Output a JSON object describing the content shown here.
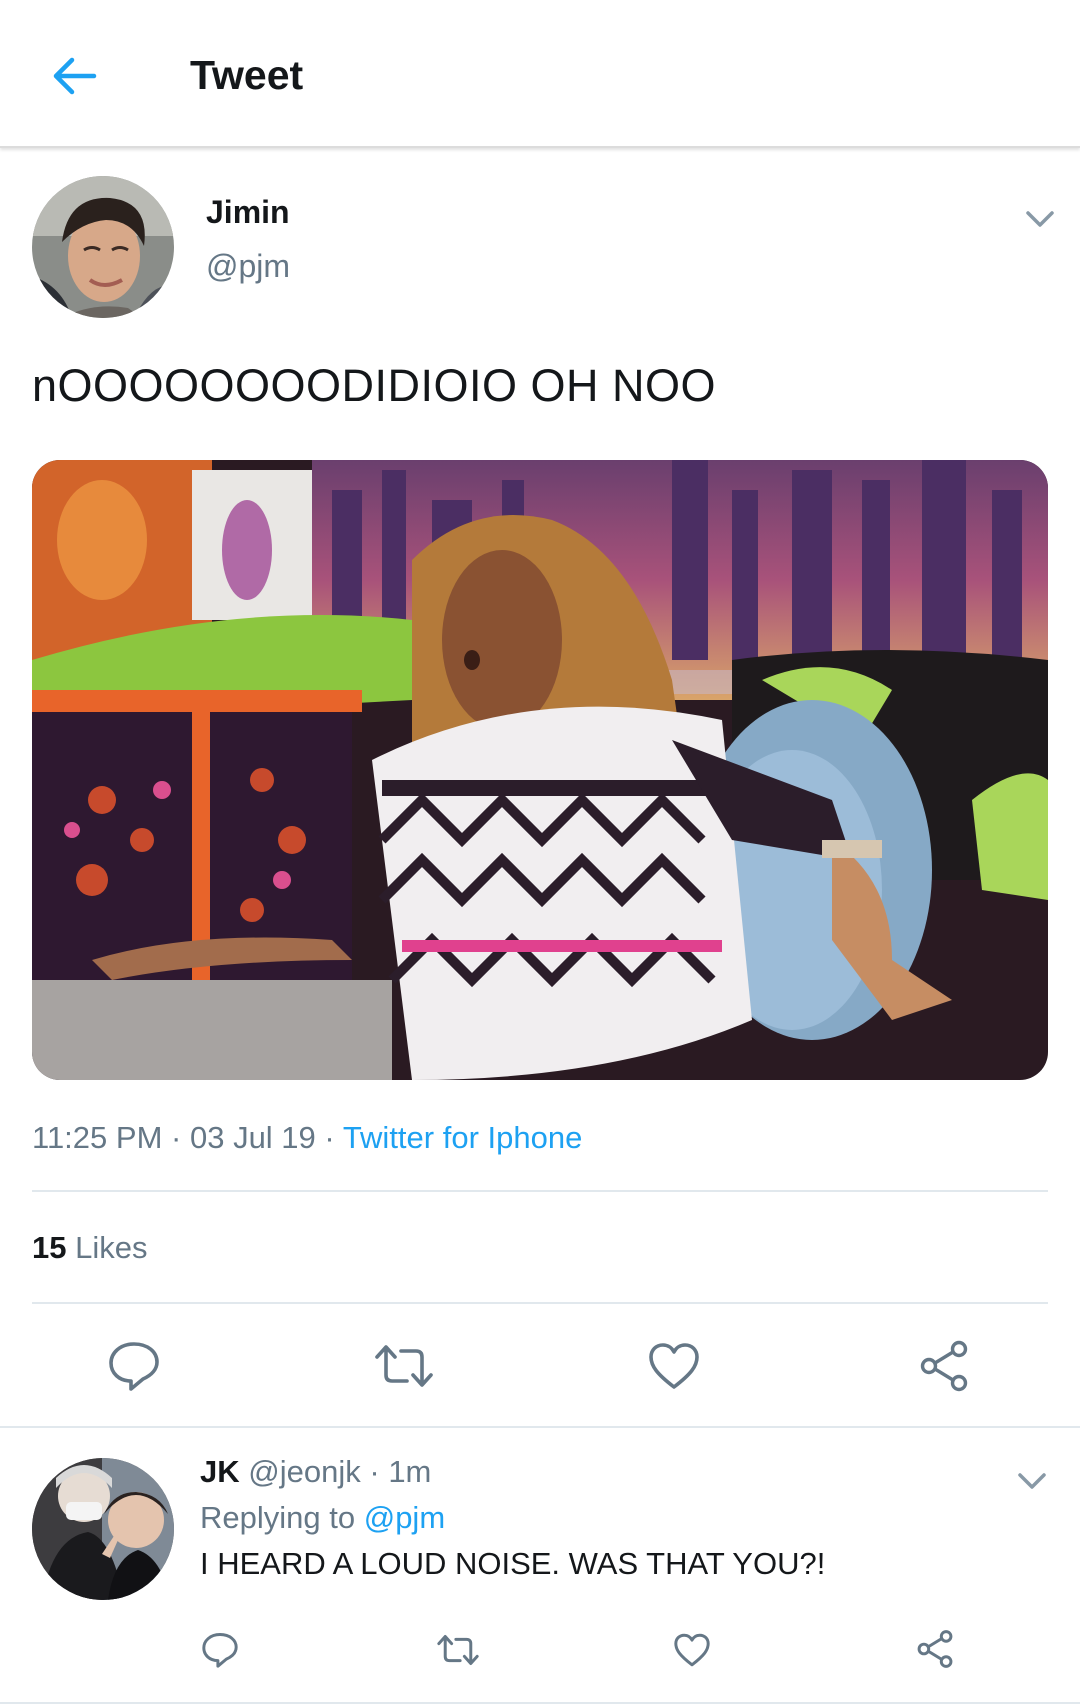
{
  "header": {
    "title": "Tweet",
    "back_icon": "arrow-left-icon"
  },
  "tweet": {
    "author": {
      "name": "Jimin",
      "handle": "@pjm"
    },
    "text": "nOOOOOOOODIDIOIO OH NOO",
    "time": "11:25 PM",
    "date": "03 Jul 19",
    "separator": "·",
    "source": "Twitter for Iphone",
    "likes": {
      "count": "15",
      "label": "Likes"
    },
    "actions": [
      "reply-icon",
      "retweet-icon",
      "like-icon",
      "share-icon"
    ]
  },
  "reply": {
    "name": "JK",
    "handle": "@jeonjk",
    "separator": "·",
    "time": "1m",
    "replying_label": "Replying to",
    "replying_to": "@pjm",
    "text": "I HEARD A LOUD NOISE. WAS THAT YOU?!",
    "actions": [
      "reply-icon",
      "retweet-icon",
      "like-icon",
      "share-icon"
    ]
  },
  "colors": {
    "accent": "#1da1f2",
    "muted": "#657786",
    "text": "#14171a",
    "divider": "#e1e8ed"
  }
}
